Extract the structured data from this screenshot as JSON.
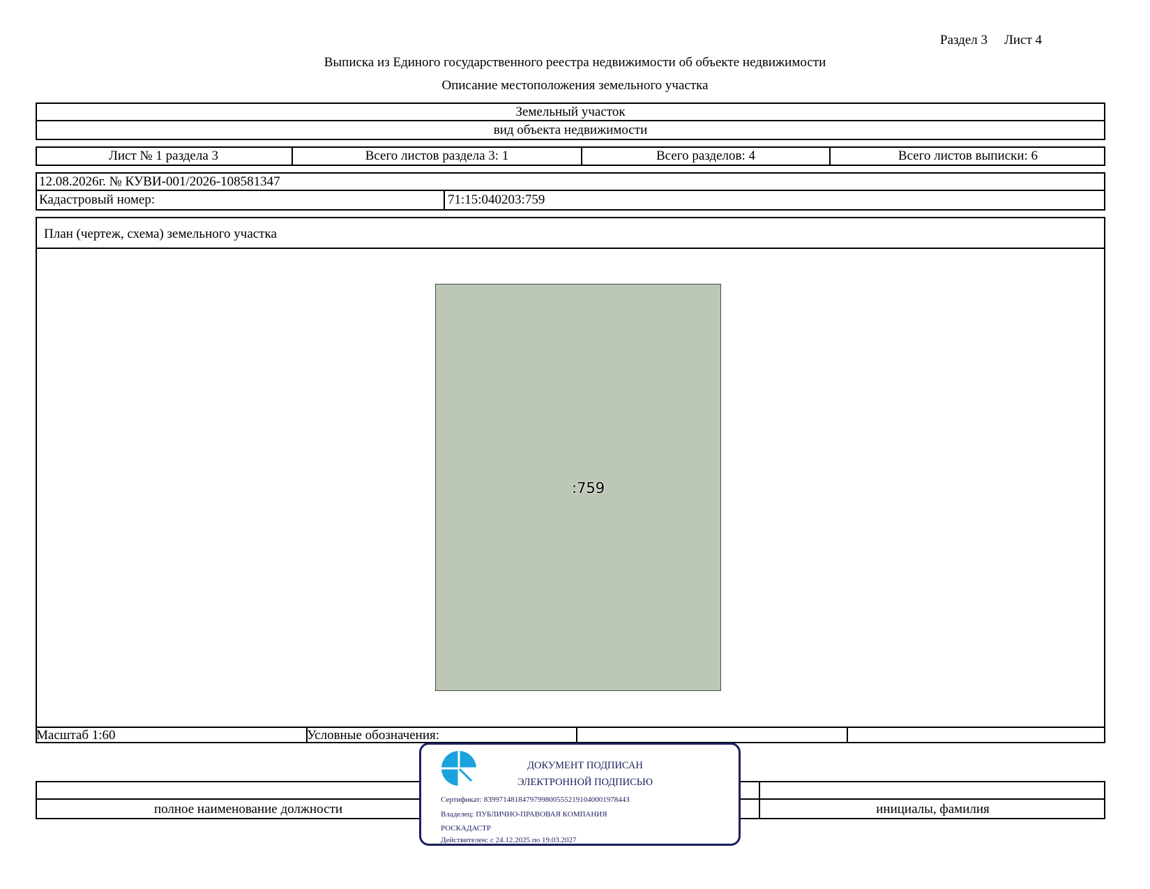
{
  "header": {
    "section": "Раздел 3",
    "sheet": "Лист 4",
    "title": "Выписка из Единого государственного реестра недвижимости об объекте недвижимости",
    "subtitle": "Описание местоположения земельного участка"
  },
  "object": {
    "type_value": "Земельный участок",
    "type_caption": "вид объекта недвижимости"
  },
  "sheets": {
    "sheet_no": "Лист № 1 раздела 3",
    "total_section_sheets": "Всего листов раздела 3: 1",
    "total_sections": "Всего разделов: 4",
    "total_extract_sheets": "Всего листов выписки: 6"
  },
  "record": {
    "date_number": "12.08.2026г. № КУВИ-001/2026-108581347",
    "cadastral_label": "Кадастровый номер:",
    "cadastral_value": "71:15:040203:759"
  },
  "plan": {
    "heading": "План (чертеж, схема) земельного участка",
    "parcel_label": ":759",
    "parcel_color": "#bcc8b5",
    "scale": "Масштаб 1:60",
    "legend_label": "Условные обозначения:"
  },
  "signature": {
    "position_caption": "полное наименование должности",
    "name_caption": "инициалы, фамилия"
  },
  "stamp": {
    "line1": "ДОКУМЕНТ ПОДПИСАН",
    "line2": "ЭЛЕКТРОННОЙ ПОДПИСЬЮ",
    "certificate": "Сертификат: 8399714818479799800555219104000197844З",
    "owner": "Владелец: ПУБЛИЧНО-ПРАВОВАЯ КОМПАНИЯ",
    "owner2": "РОСКАДАСТР",
    "valid": "Действителен: с 24.12.2025 по 19.03.2027",
    "border_color": "#1a1f5e",
    "logo_color": "#1aa3dd"
  }
}
